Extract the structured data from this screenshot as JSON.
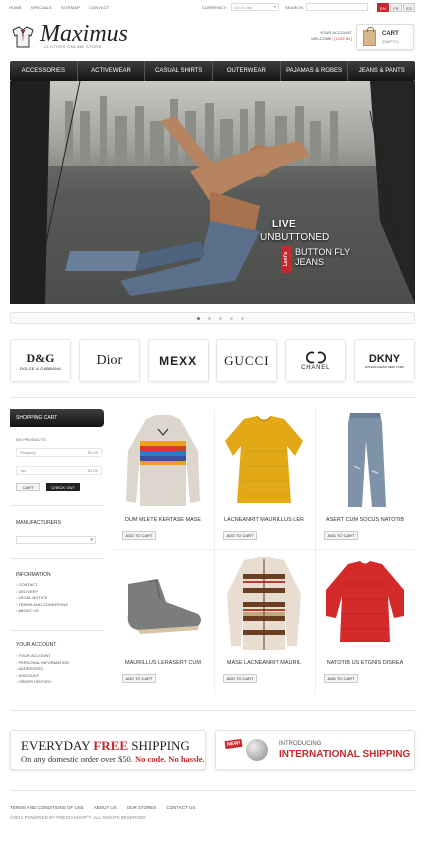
{
  "topbar": {
    "nav": [
      "Home",
      "Specials",
      "Sitemap",
      "Contact"
    ],
    "currency_label": "Currency:",
    "currency_value": "US Dollar",
    "search_label": "Search:",
    "languages": [
      "EN",
      "FR",
      "ES"
    ]
  },
  "header": {
    "logo": "Maximus",
    "slogan": "Clothes online store",
    "account_label": "Your account",
    "welcome": "Welcome,",
    "login": "[ Log in ]",
    "cart_title": "Cart",
    "cart_status": "(Empty)"
  },
  "mainnav": [
    "Accessories",
    "Activewear",
    "Casual Shirts",
    "Outerwear",
    "Pajamas & Robes",
    "Jeans & Pants"
  ],
  "hero": {
    "line1": "Live",
    "line2": "Unbuttoned",
    "brand": "Levi's",
    "line3": "Button Fly",
    "line4": "Jeans",
    "slide_count": 5,
    "active_slide": 1
  },
  "brands": {
    "dg_main": "D&G",
    "dg_sub": "DOLCE & GABBANA",
    "dior": "Dior",
    "mexx": "MEXX",
    "gucci": "GUCCI",
    "chanel": "CHANEL",
    "dkny_main": "DKNY",
    "dkny_sub": "DONNA KARAN NEW YORK"
  },
  "sidebar": {
    "cart_head": "Shopping Cart",
    "cart_info": "No products",
    "shipping_label": "Shipping",
    "shipping_value": "$1.00",
    "tax_label": "Tax",
    "tax_value": "$1.00",
    "cart_btn": "Cart",
    "checkout_btn": "Check out",
    "manufacturers": "Manufacturers",
    "information": "Information",
    "info_links": [
      "Contact",
      "Delivery",
      "Legal Notice",
      "Terms and conditions",
      "About us"
    ],
    "account": "Your Account",
    "account_links": [
      "Your account",
      "Personal information",
      "Addresses",
      "Discount",
      "Order history"
    ]
  },
  "products": [
    {
      "name": "Dum mlete kertase mase",
      "button": "Add to cart"
    },
    {
      "name": "Lacneanrit maurillus ler",
      "button": "Add to cart"
    },
    {
      "name": "Asert cum socus natotib",
      "button": "Add to cart"
    },
    {
      "name": "Maurillus lerasert cum",
      "button": "Add to cart"
    },
    {
      "name": "Mase lacneanrit mauril",
      "button": "Add to cart"
    },
    {
      "name": "Natotib us etgnis disrea",
      "button": "Add to cart"
    }
  ],
  "banners": {
    "ship_a": "Everyday",
    "ship_b": "Free",
    "ship_c": "Shipping",
    "ship_line_a": "On any domestic order over $50.",
    "ship_line_b": "No code. No hassle.",
    "new_tag": "New!",
    "intl_small": "Introducing",
    "intl_big": "International Shipping"
  },
  "footer": {
    "links": [
      "Terms and conditions of use",
      "About us",
      "Our stores",
      "Contact us"
    ],
    "copyright": "©2012 Powered by PrestaShop™. All rights reserved"
  },
  "colors": {
    "accent": "#c8282d",
    "nav_dark": "#1e1e1e"
  }
}
